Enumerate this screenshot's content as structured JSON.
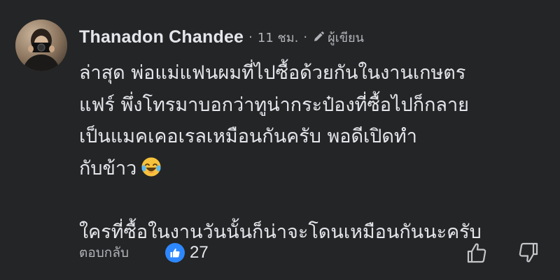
{
  "comment": {
    "author": "Thanadon Chandee",
    "time": "11 ชม.",
    "author_badge": "ผู้เขียน",
    "avatar_icon": "person-with-camera-avatar",
    "lines": [
      "ล่าสุด พ่อแม่แฟนผมที่ไปซื้อด้วยกันในงานเกษตร",
      "แฟร์ พึ่งโทรมาบอกว่าทูน่ากระป๋องที่ซื้อไปก็กลาย",
      "เป็นแมคเคอเรลเหมือนกันครับ พอดีเปิดทำ",
      "กับข้าว"
    ],
    "emoji": "laughing-with-tears-emoji",
    "last_line": "ใครที่ซื้อในงานวันนั้นก็น่าจะโดนเหมือนกันนะครับ"
  },
  "footer": {
    "reply_label": "ตอบกลับ",
    "like_icon": "thumbs-up-icon",
    "like_count": "27",
    "upvote_icon": "upvote-icon",
    "downvote_icon": "downvote-icon"
  },
  "colors": {
    "background": "#242526",
    "primary_text": "#e4e6eb",
    "secondary_text": "#b0b3b8",
    "like_blue": "#2d88ff"
  }
}
